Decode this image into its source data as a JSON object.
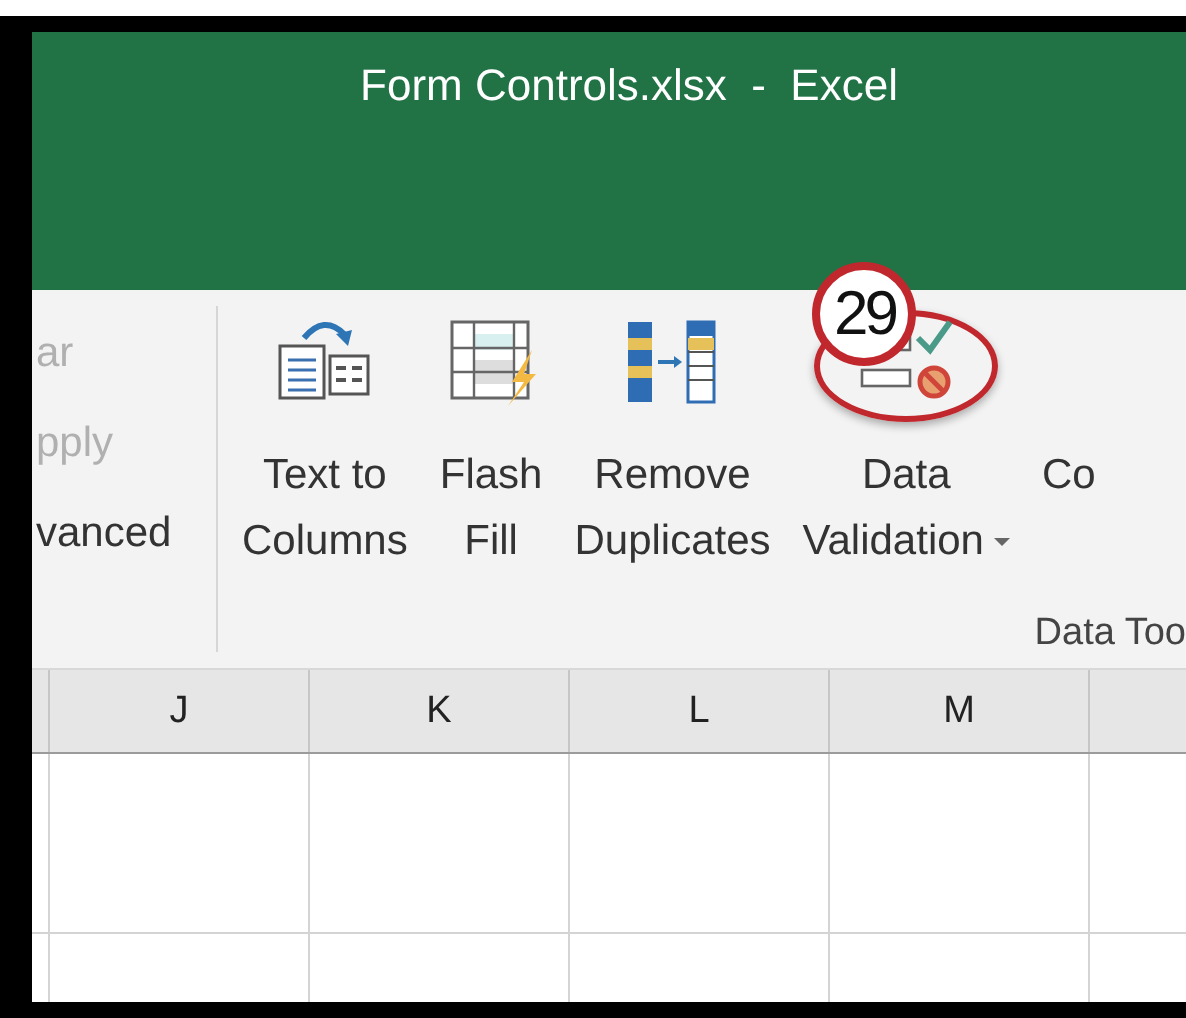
{
  "window": {
    "title": "Form Controls.xlsx  -  Excel"
  },
  "ribbon": {
    "partial_group": [
      {
        "label": "ar",
        "disabled": true
      },
      {
        "label": "pply",
        "disabled": true
      },
      {
        "label": "vanced",
        "disabled": false
      }
    ],
    "buttons": [
      {
        "kind": "text-to-columns",
        "lines": [
          "Text to",
          "Columns"
        ],
        "dropdown": false
      },
      {
        "kind": "flash-fill",
        "lines": [
          "Flash",
          "Fill"
        ],
        "dropdown": false
      },
      {
        "kind": "remove-duplicates",
        "lines": [
          "Remove",
          "Duplicates"
        ],
        "dropdown": false
      },
      {
        "kind": "data-validation",
        "lines": [
          "Data",
          "Validation"
        ],
        "dropdown": true
      },
      {
        "kind": "partial",
        "lines": [
          "Co"
        ],
        "dropdown": false
      }
    ],
    "group_label": "Data Too",
    "callout": {
      "number": "29"
    }
  },
  "sheet": {
    "columns": [
      "J",
      "K",
      "L",
      "M"
    ]
  }
}
